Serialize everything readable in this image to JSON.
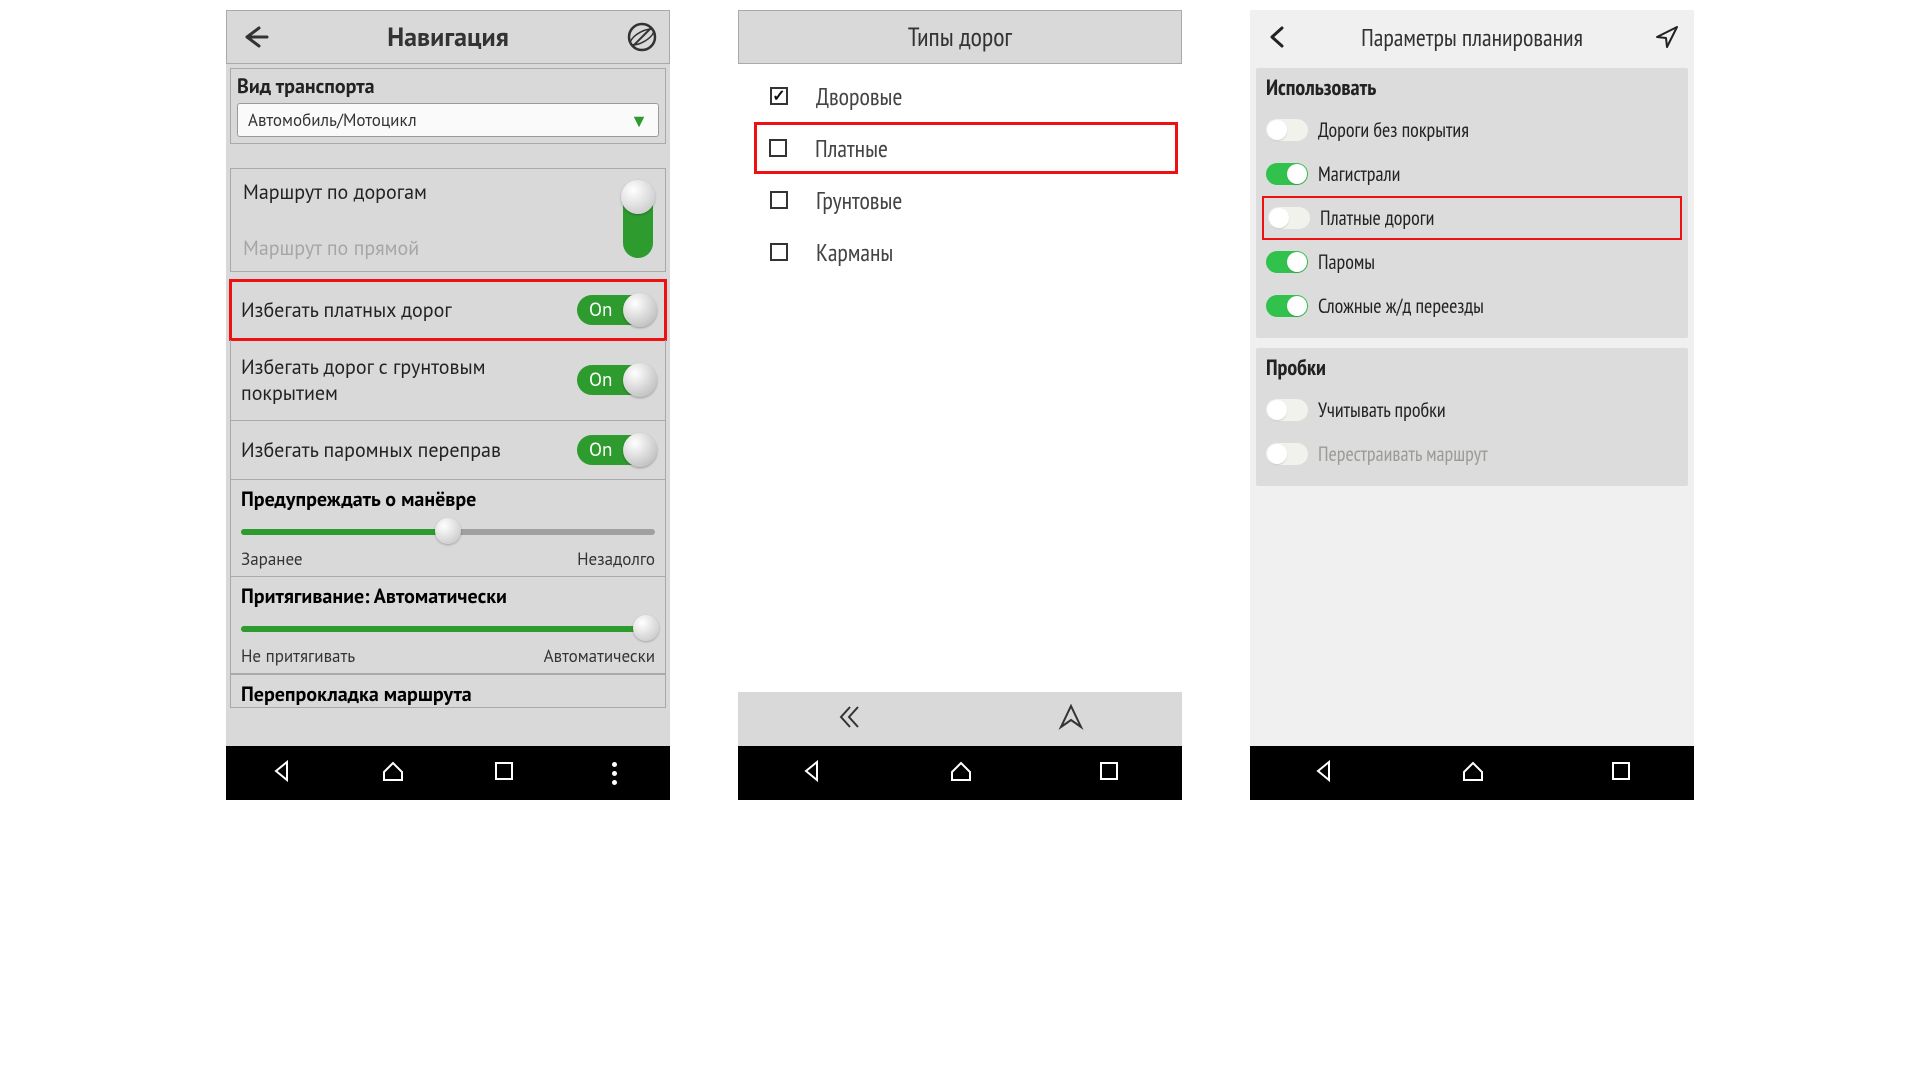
{
  "screen1": {
    "title": "Навигация",
    "transport_label": "Вид транспорта",
    "transport_value": "Автомобиль/Мотоцикл",
    "routeByRoads": "Маршрут по дорогам",
    "routeStraight": "Маршрут по прямой",
    "avoid_toll": "Избегать платных дорог",
    "avoid_dirt": "Избегать дорог с грунтовым покрытием",
    "avoid_ferry": "Избегать паромных переправ",
    "on_label": "On",
    "warn_title": "Предупреждать о манёвре",
    "warn_left": "Заранее",
    "warn_right": "Незадолго",
    "snap_title": "Притягивание: Автоматически",
    "snap_left": "Не притягивать",
    "snap_right": "Автоматически",
    "reroute_title": "Перепрокладка маршрута"
  },
  "screen2": {
    "title": "Типы дорог",
    "items": [
      {
        "label": "Дворовые",
        "checked": true,
        "highlight": false
      },
      {
        "label": "Платные",
        "checked": false,
        "highlight": true
      },
      {
        "label": "Грунтовые",
        "checked": false,
        "highlight": false
      },
      {
        "label": "Карманы",
        "checked": false,
        "highlight": false
      }
    ]
  },
  "screen3": {
    "title": "Параметры планирования",
    "group1_title": "Использовать",
    "group1_opts": [
      {
        "label": "Дороги без покрытия",
        "on": false,
        "highlight": false,
        "dim": false
      },
      {
        "label": "Магистрали",
        "on": true,
        "highlight": false,
        "dim": false
      },
      {
        "label": "Платные дороги",
        "on": false,
        "highlight": true,
        "dim": false
      },
      {
        "label": "Паромы",
        "on": true,
        "highlight": false,
        "dim": false
      },
      {
        "label": "Сложные ж/д переезды",
        "on": true,
        "highlight": false,
        "dim": false
      }
    ],
    "group2_title": "Пробки",
    "group2_opts": [
      {
        "label": "Учитывать пробки",
        "on": false,
        "highlight": false,
        "dim": false
      },
      {
        "label": "Перестраивать маршрут",
        "on": false,
        "highlight": false,
        "dim": true
      }
    ]
  }
}
